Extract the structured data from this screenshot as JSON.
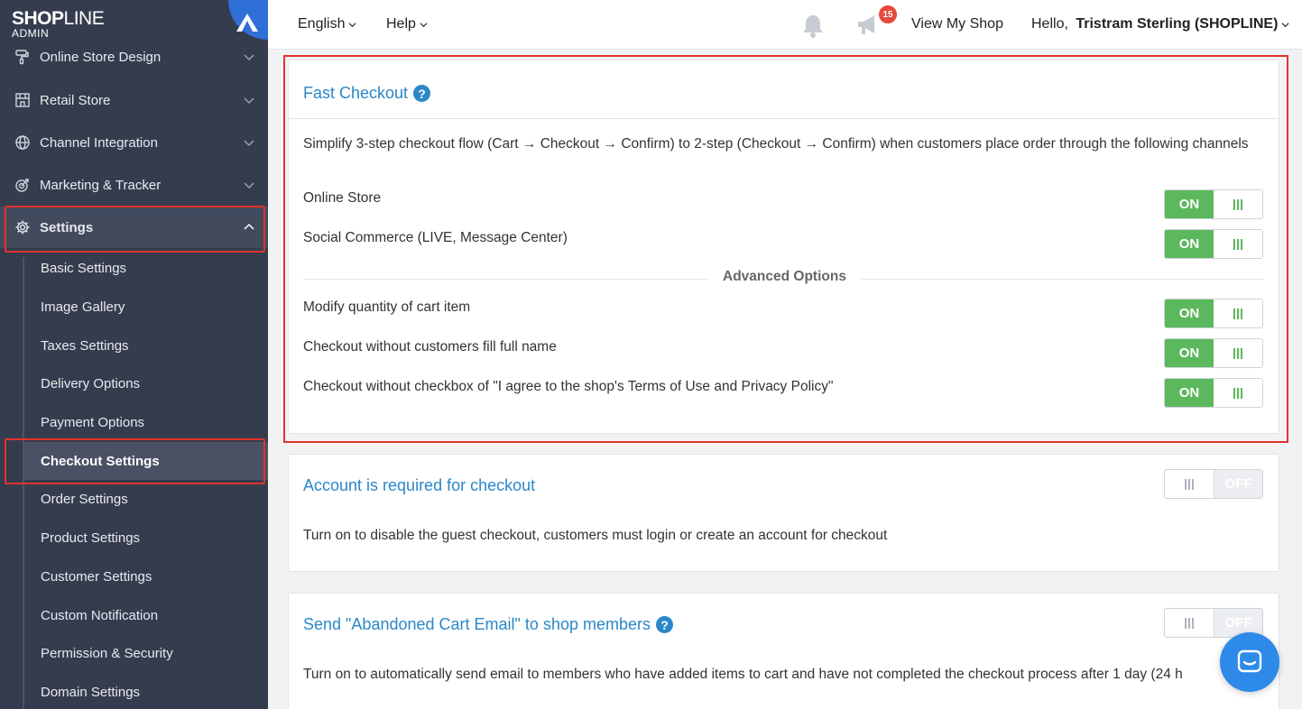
{
  "brand": {
    "logo_bold": "SHOP",
    "logo_light": "LINE",
    "logo_sub": "ADMIN"
  },
  "sidebar": {
    "items": [
      {
        "label": "Online Store Design"
      },
      {
        "label": "Retail Store"
      },
      {
        "label": "Channel Integration"
      },
      {
        "label": "Marketing & Tracker"
      },
      {
        "label": "Settings"
      }
    ],
    "sub_items": [
      {
        "label": "Basic Settings"
      },
      {
        "label": "Image Gallery"
      },
      {
        "label": "Taxes Settings"
      },
      {
        "label": "Delivery Options"
      },
      {
        "label": "Payment Options"
      },
      {
        "label": "Checkout Settings"
      },
      {
        "label": "Order Settings"
      },
      {
        "label": "Product Settings"
      },
      {
        "label": "Customer Settings"
      },
      {
        "label": "Custom Notification"
      },
      {
        "label": "Permission & Security"
      },
      {
        "label": "Domain Settings"
      }
    ]
  },
  "topbar": {
    "language": "English",
    "help": "Help",
    "notification_count": "15",
    "view_shop": "View My Shop",
    "greeting": "Hello, ",
    "user": "Tristram Sterling (SHOPLINE)"
  },
  "fast_checkout": {
    "title": "Fast Checkout",
    "description": "Simplify 3-step checkout flow (Cart → Checkout → Confirm) to 2-step (Checkout → Confirm) when customers place order through the following channels",
    "options": [
      {
        "label": "Online Store",
        "state": "ON"
      },
      {
        "label": "Social Commerce (LIVE, Message Center)",
        "state": "ON"
      }
    ],
    "advanced_label": "Advanced Options",
    "advanced": [
      {
        "label": "Modify quantity of cart item",
        "state": "ON"
      },
      {
        "label": "Checkout without customers fill full name",
        "state": "ON"
      },
      {
        "label": "Checkout without checkbox of \"I agree to the shop's Terms of Use and Privacy Policy\"",
        "state": "ON"
      }
    ]
  },
  "account_required": {
    "title": "Account is required for checkout",
    "description": "Turn on to disable the guest checkout, customers must login or create an account for checkout",
    "state": "OFF"
  },
  "abandoned_cart": {
    "title": "Send \"Abandoned Cart Email\" to shop members",
    "description": "Turn on to automatically send email to members who have added items to cart and have not completed the checkout process after 1 day (24 h",
    "state": "OFF"
  },
  "help_glyph": "?",
  "colors": {
    "accent": "#2a87c8",
    "on": "#5cb85c",
    "sidebar": "#353c4e",
    "highlight": "#e0342b"
  }
}
